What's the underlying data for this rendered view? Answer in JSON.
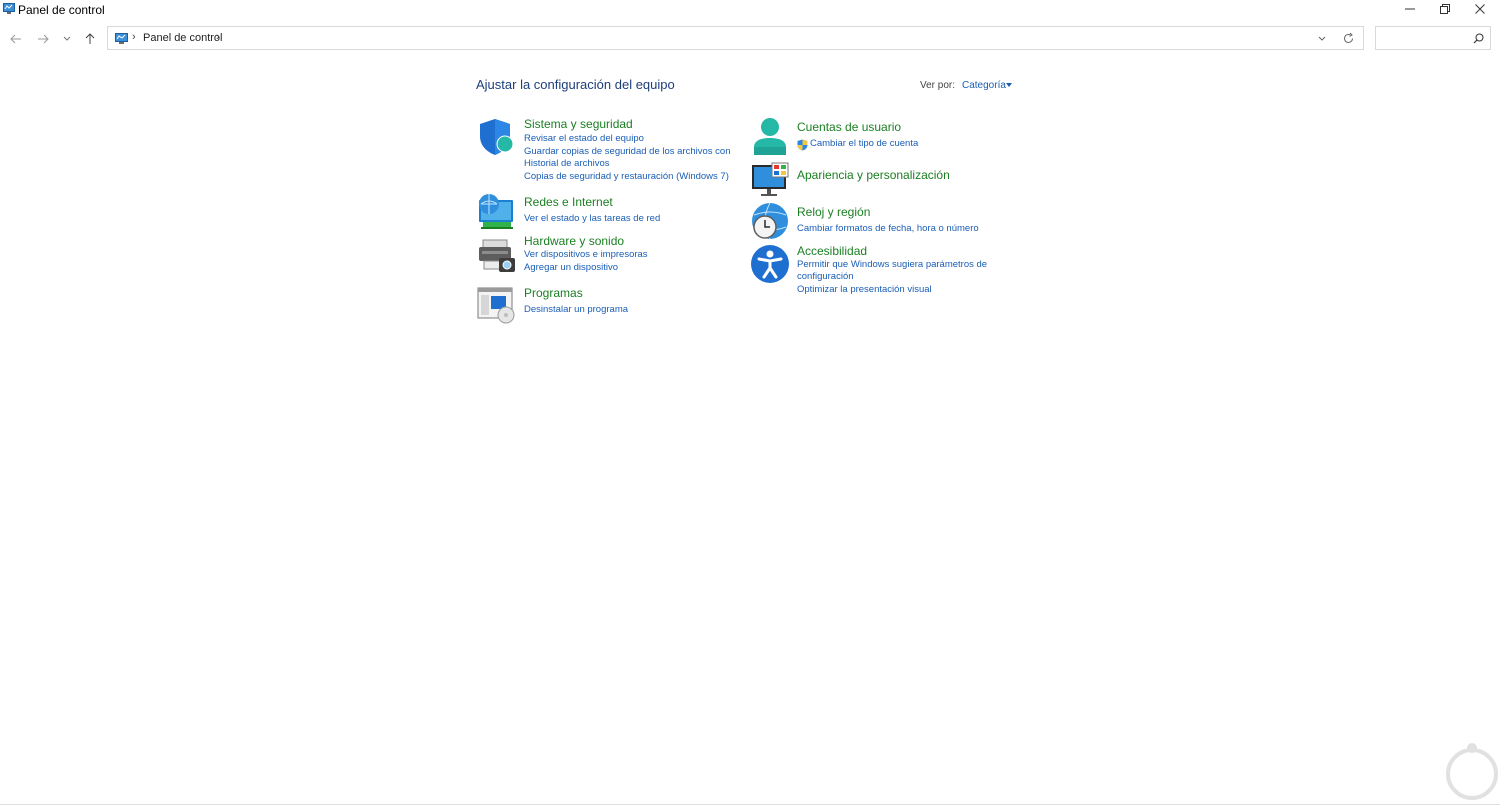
{
  "window": {
    "title": "Panel de control",
    "icon": "control-panel-icon",
    "controls": [
      "minimize-icon",
      "restore-icon",
      "close-icon"
    ]
  },
  "addressbar": {
    "breadcrumb": [
      "Panel de control"
    ],
    "search_placeholder": ""
  },
  "header": {
    "title": "Ajustar la configuración del equipo",
    "view_by_label": "Ver por:",
    "view_by_value": "Categoría"
  },
  "categories": [
    {
      "title": "Sistema y seguridad",
      "icon": "shield-icon",
      "links": [
        "Revisar el estado del equipo",
        "Guardar copias de seguridad de los archivos con",
        "Historial de archivos",
        "Copias de seguridad y restauración (Windows 7)"
      ]
    },
    {
      "title": "Redes e Internet",
      "icon": "network-globe-icon",
      "links": [
        "Ver el estado y las tareas de red"
      ]
    },
    {
      "title": "Hardware y sonido",
      "icon": "printer-camera-icon",
      "links": [
        "Ver dispositivos e impresoras",
        "Agregar un dispositivo"
      ]
    },
    {
      "title": "Programas",
      "icon": "programs-window-icon",
      "links": [
        "Desinstalar un programa"
      ]
    },
    {
      "title": "Cuentas de usuario",
      "icon": "user-icon",
      "links": [
        "Cambiar el tipo de cuenta"
      ]
    },
    {
      "title": "Apariencia y personalización",
      "icon": "monitor-palette-icon",
      "links": []
    },
    {
      "title": "Reloj y región",
      "icon": "clock-globe-icon",
      "links": [
        "Cambiar formatos de fecha, hora o número"
      ]
    },
    {
      "title": "Accesibilidad",
      "icon": "accessibility-icon",
      "links": [
        "Permitir que Windows sugiera parámetros de",
        "configuración",
        "Optimizar la presentación visual"
      ]
    }
  ],
  "colors": {
    "category_title": "#1b7f22",
    "link": "#1a5eb5",
    "heading": "#1e3e7a"
  }
}
